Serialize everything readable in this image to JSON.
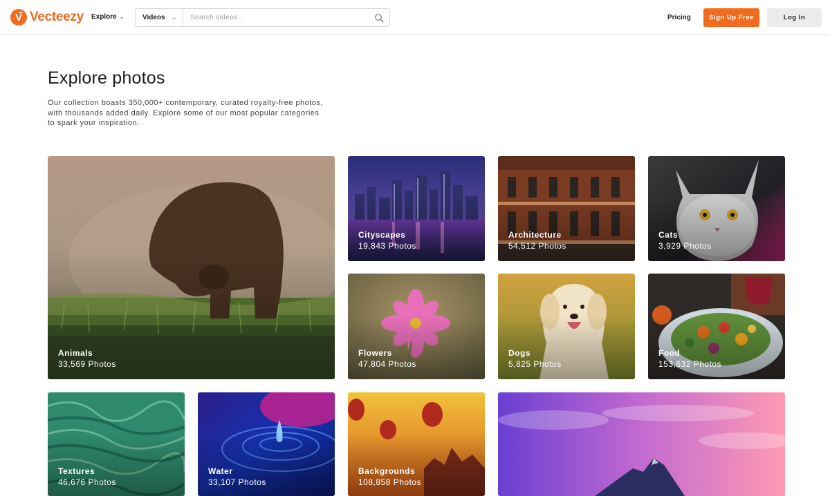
{
  "brand": {
    "name": "Vecteezy",
    "color": "#f06b1d"
  },
  "header": {
    "explore_label": "Explore",
    "search": {
      "type_label": "Videos",
      "placeholder": "Search videos..."
    },
    "pricing_label": "Pricing",
    "signup_label": "Sign Up Free",
    "login_label": "Log In"
  },
  "intro": {
    "title": "Explore photos",
    "description": "Our collection boasts 350,000+ contemporary, curated royalty-free photos, with thousands added daily. Explore some of our most popular categories to spark your inspiration."
  },
  "categories": [
    {
      "name": "Animals",
      "count": "33,569 Photos"
    },
    {
      "name": "Cityscapes",
      "count": "19,843 Photos"
    },
    {
      "name": "Architecture",
      "count": "54,512 Photos"
    },
    {
      "name": "Cats",
      "count": "3,929 Photos"
    },
    {
      "name": "Flowers",
      "count": "47,804 Photos"
    },
    {
      "name": "Dogs",
      "count": "5,825 Photos"
    },
    {
      "name": "Food",
      "count": "153,632 Photos"
    },
    {
      "name": "Textures",
      "count": "46,676 Photos"
    },
    {
      "name": "Water",
      "count": "33,107 Photos"
    },
    {
      "name": "Backgrounds",
      "count": "108,858 Photos"
    },
    {
      "name": "",
      "count": ""
    }
  ],
  "icons": [
    "chevron-down-icon",
    "search-icon",
    "vecteezy-logo"
  ]
}
